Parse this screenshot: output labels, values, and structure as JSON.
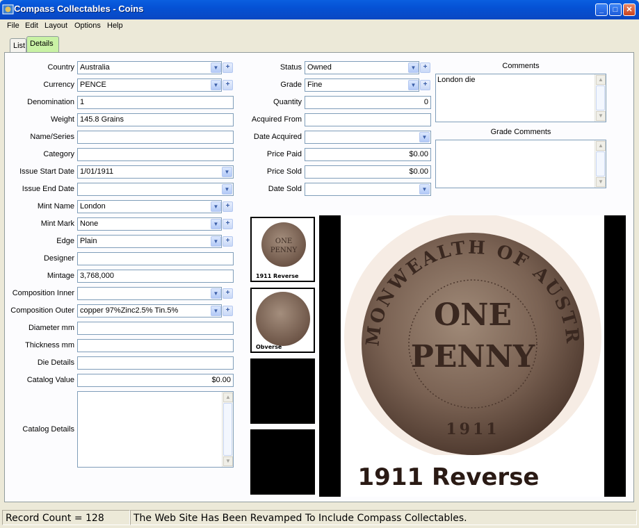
{
  "window": {
    "title": "Compass Collectables - Coins",
    "app_icon": "compass-app-icon"
  },
  "menu": [
    "File",
    "Edit",
    "Layout",
    "Options",
    "Help"
  ],
  "tabs": [
    {
      "label": "List",
      "active": false
    },
    {
      "label": "Details",
      "active": true
    }
  ],
  "left_fields": {
    "country": {
      "label": "Country",
      "value": "Australia"
    },
    "currency": {
      "label": "Currency",
      "value": "PENCE"
    },
    "denomination": {
      "label": "Denomination",
      "value": "1"
    },
    "weight": {
      "label": "Weight",
      "value": "145.8 Grains"
    },
    "name_series": {
      "label": "Name/Series",
      "value": ""
    },
    "category": {
      "label": "Category",
      "value": ""
    },
    "issue_start": {
      "label": "Issue Start Date",
      "value": "1/01/1911"
    },
    "issue_end": {
      "label": "Issue End Date",
      "value": ""
    },
    "mint_name": {
      "label": "Mint Name",
      "value": "London"
    },
    "mint_mark": {
      "label": "Mint Mark",
      "value": "None"
    },
    "edge": {
      "label": "Edge",
      "value": "Plain"
    },
    "designer": {
      "label": "Designer",
      "value": ""
    },
    "mintage": {
      "label": "Mintage",
      "value": "3,768,000"
    },
    "comp_inner": {
      "label": "Composition Inner",
      "value": ""
    },
    "comp_outer": {
      "label": "Composition Outer",
      "value": "copper 97%Zinc2.5% Tin.5%"
    },
    "diameter": {
      "label": "Diameter mm",
      "value": ""
    },
    "thickness": {
      "label": "Thickness mm",
      "value": ""
    },
    "die_details": {
      "label": "Die Details",
      "value": ""
    },
    "catalog_value": {
      "label": "Catalog Value",
      "value": "$0.00"
    },
    "catalog_details": {
      "label": "Catalog Details",
      "value": ""
    }
  },
  "mid_fields": {
    "status": {
      "label": "Status",
      "value": "Owned"
    },
    "grade": {
      "label": "Grade",
      "value": "Fine"
    },
    "quantity": {
      "label": "Quantity",
      "value": "0"
    },
    "acquired_from": {
      "label": "Acquired From",
      "value": ""
    },
    "date_acquired": {
      "label": "Date Acquired",
      "value": ""
    },
    "price_paid": {
      "label": "Price Paid",
      "value": "$0.00"
    },
    "price_sold": {
      "label": "Price Sold",
      "value": "$0.00"
    },
    "date_sold": {
      "label": "Date Sold",
      "value": ""
    }
  },
  "comments": {
    "label": "Comments",
    "value": "London die"
  },
  "grade_comments": {
    "label": "Grade Comments",
    "value": ""
  },
  "thumbnails": [
    {
      "caption": "1911 Reverse"
    },
    {
      "caption": "Obverse"
    }
  ],
  "main_image": {
    "legend_top": "COMMONWEALTH OF AUSTRALIA",
    "center_line1": "ONE",
    "center_line2": "PENNY",
    "year": "1911",
    "caption": "1911 Reverse"
  },
  "status": {
    "record_count": "Record Count = 128",
    "message": "The Web Site Has Been Revamped To Include Compass Collectables."
  }
}
